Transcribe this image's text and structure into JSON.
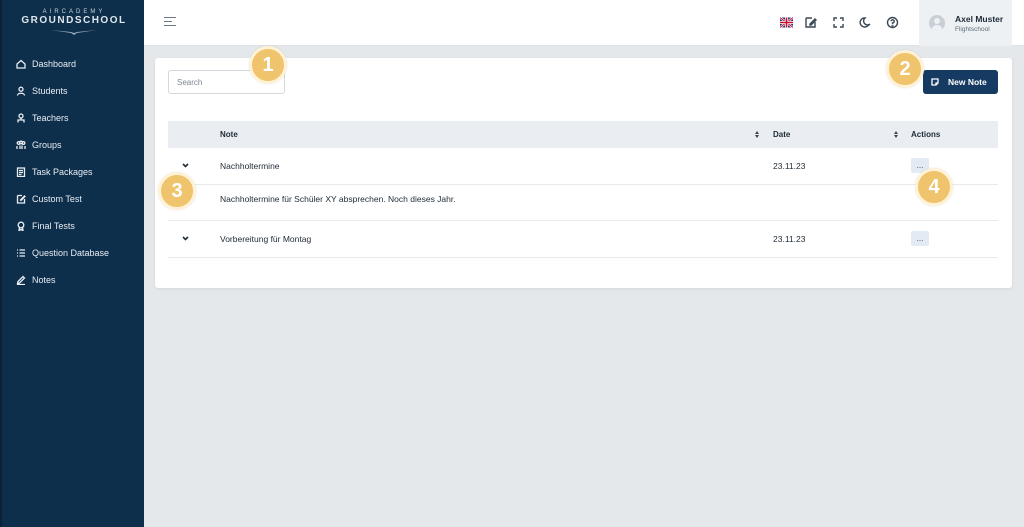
{
  "sidebar": {
    "logo_top": "AIRCADEMY",
    "logo_main": "GROUNDSCHOOL",
    "items": [
      {
        "label": "Dashboard",
        "icon": "home-icon"
      },
      {
        "label": "Students",
        "icon": "user-icon"
      },
      {
        "label": "Teachers",
        "icon": "teacher-icon"
      },
      {
        "label": "Groups",
        "icon": "groups-icon"
      },
      {
        "label": "Task Packages",
        "icon": "task-packages-icon"
      },
      {
        "label": "Custom Test",
        "icon": "custom-test-icon"
      },
      {
        "label": "Final Tests",
        "icon": "award-icon"
      },
      {
        "label": "Question Database",
        "icon": "list-icon"
      },
      {
        "label": "Notes",
        "icon": "pencil-icon"
      }
    ]
  },
  "topbar": {
    "icons": [
      "uk-flag-icon",
      "edit-note-icon",
      "fullscreen-icon",
      "moon-icon",
      "help-icon"
    ],
    "user": {
      "name": "Axel Muster",
      "role": "Flightschool"
    }
  },
  "notes": {
    "search_placeholder": "Search",
    "new_note_label": "New Note",
    "columns": {
      "note": "Note",
      "date": "Date",
      "actions": "Actions"
    },
    "rows": [
      {
        "title": "Nachholtermine",
        "date": "23.11.23",
        "action": "...",
        "expanded": true,
        "detail": "Nachholtermine für Schüler XY absprechen. Noch dieses Jahr."
      },
      {
        "title": "Vorbereitung für Montag",
        "date": "23.11.23",
        "action": "...",
        "expanded": false
      }
    ]
  },
  "callouts": [
    "1",
    "2",
    "3",
    "4"
  ],
  "colors": {
    "sidebar": "#0e2f4b",
    "primary": "#163b62",
    "callout": "#f0c36d",
    "background": "#e4e8eb"
  }
}
